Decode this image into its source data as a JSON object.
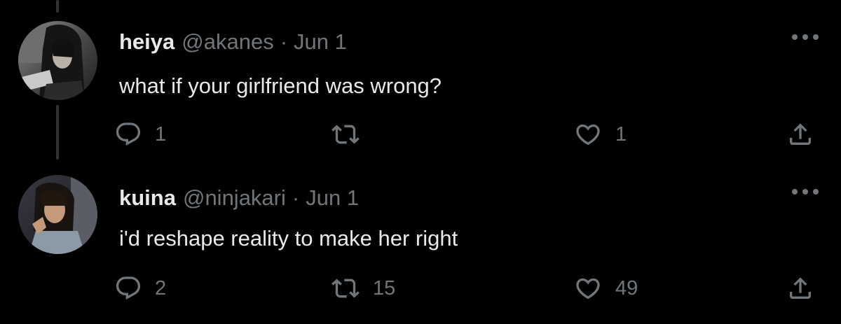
{
  "tweets": [
    {
      "name": "heiya",
      "handle": "@akanes",
      "separator": "·",
      "date": "Jun 1",
      "text": "what if your girlfriend was wrong?",
      "reply_count": "1",
      "retweet_count": "",
      "like_count": "1"
    },
    {
      "name": "kuina",
      "handle": "@ninjakari",
      "separator": "·",
      "date": "Jun 1",
      "text": "i'd reshape reality to make her right",
      "reply_count": "2",
      "retweet_count": "15",
      "like_count": "49"
    }
  ],
  "icons": {
    "reply": "reply-icon",
    "retweet": "retweet-icon",
    "like": "heart-icon",
    "share": "share-icon",
    "more": "more-icon"
  },
  "colors": {
    "background": "#000000",
    "primary_text": "#e7e9ea",
    "secondary_text": "#71767b",
    "thread_line": "#2f3336"
  }
}
